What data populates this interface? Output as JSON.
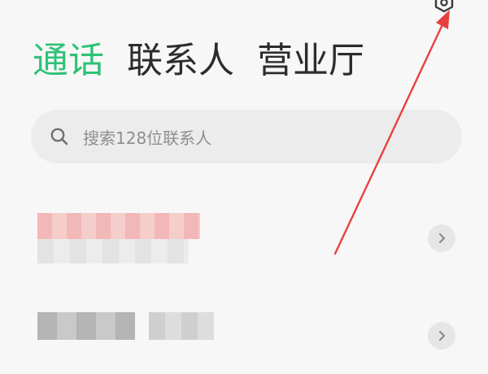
{
  "tabs": [
    {
      "label": "通话",
      "active": true
    },
    {
      "label": "联系人",
      "active": false
    },
    {
      "label": "营业厅",
      "active": false
    }
  ],
  "search": {
    "placeholder": "搜索128位联系人",
    "icon": "search-icon"
  },
  "header": {
    "settings_icon": "settings-hexagon-icon"
  },
  "contacts": [
    {
      "name": "",
      "detail": "",
      "obscured": true
    },
    {
      "name": "",
      "detail": "",
      "obscured": true
    }
  ],
  "colors": {
    "accent": "#2fc277",
    "tab_text": "#2c2c2c",
    "background": "#f7f7f7",
    "search_background": "#ececec",
    "annotation_arrow": "#e8413d"
  }
}
